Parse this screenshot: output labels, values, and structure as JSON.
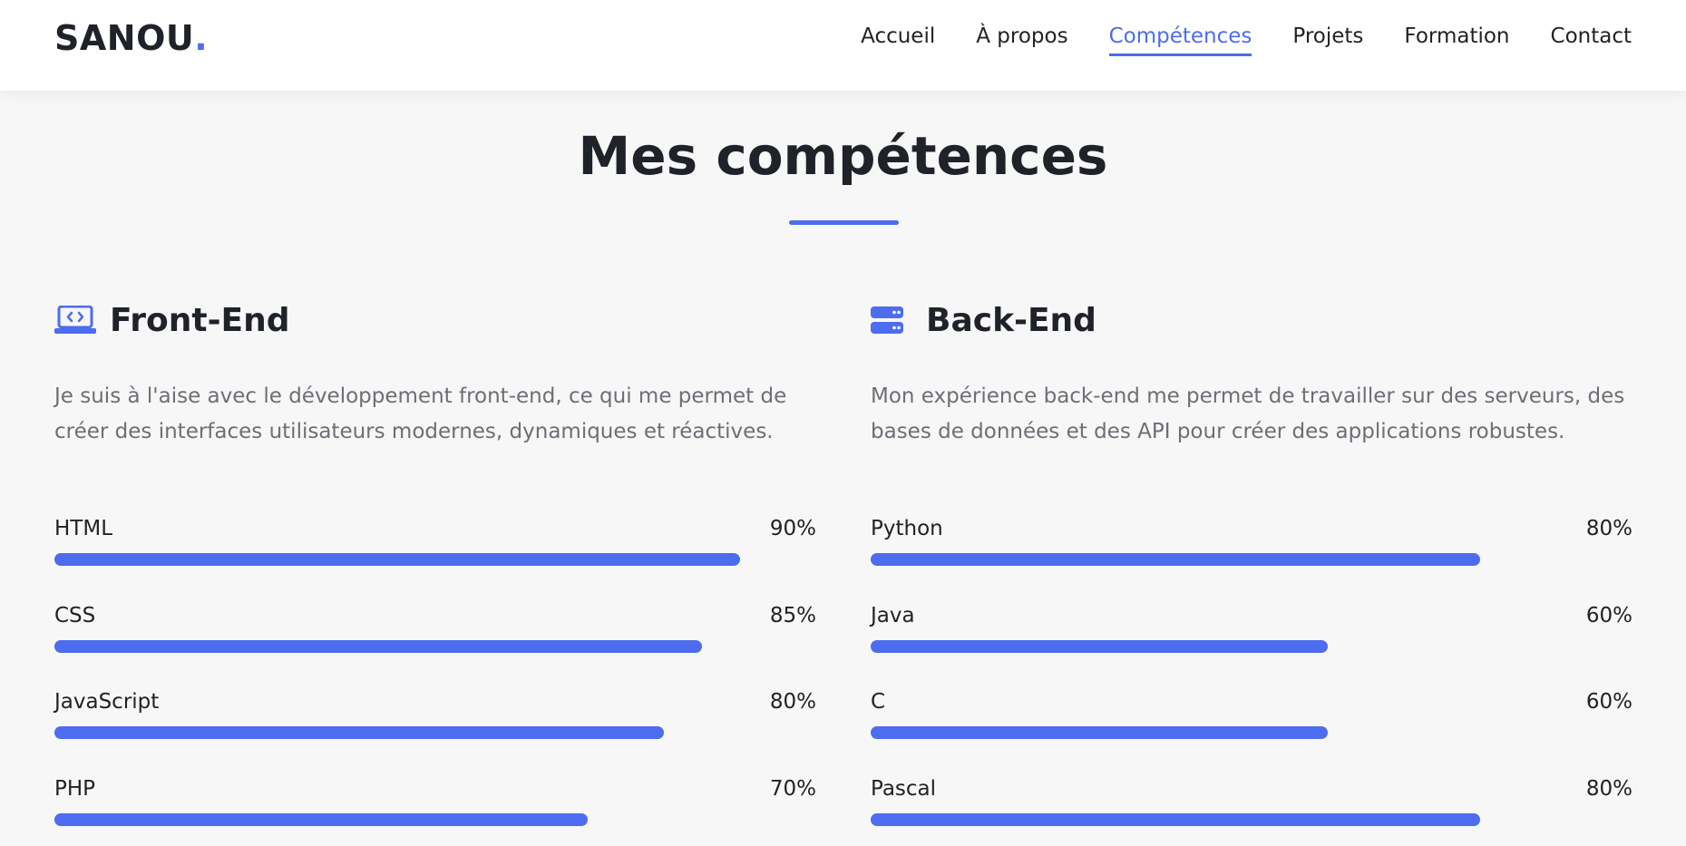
{
  "header": {
    "logo_text": "SANOU",
    "logo_dot": ".",
    "nav": [
      {
        "label": "Accueil"
      },
      {
        "label": "À propos"
      },
      {
        "label": "Compétences",
        "active": true
      },
      {
        "label": "Projets"
      },
      {
        "label": "Formation"
      },
      {
        "label": "Contact"
      }
    ]
  },
  "section": {
    "title": "Mes compétences"
  },
  "frontend": {
    "icon": "laptop-code-icon",
    "title": "Front-End",
    "description": "Je suis à l'aise avec le développement front-end, ce qui me permet de créer des interfaces utilisateurs modernes, dynamiques et réactives.",
    "skills": [
      {
        "name": "HTML",
        "percent_label": "90%",
        "percent": 90
      },
      {
        "name": "CSS",
        "percent_label": "85%",
        "percent": 85
      },
      {
        "name": "JavaScript",
        "percent_label": "80%",
        "percent": 80
      },
      {
        "name": "PHP",
        "percent_label": "70%",
        "percent": 70
      }
    ]
  },
  "backend": {
    "icon": "server-icon",
    "title": "Back-End",
    "description": "Mon expérience back-end me permet de travailler sur des serveurs, des bases de données et des API pour créer des applications robustes.",
    "skills": [
      {
        "name": "Python",
        "percent_label": "80%",
        "percent": 80
      },
      {
        "name": "Java",
        "percent_label": "60%",
        "percent": 60
      },
      {
        "name": "C",
        "percent_label": "60%",
        "percent": 60
      },
      {
        "name": "Pascal",
        "percent_label": "80%",
        "percent": 80
      }
    ]
  },
  "colors": {
    "accent": "#4d6cf0",
    "text": "#1f2329",
    "muted": "#6b6f76",
    "background": "#f7f7f7"
  }
}
